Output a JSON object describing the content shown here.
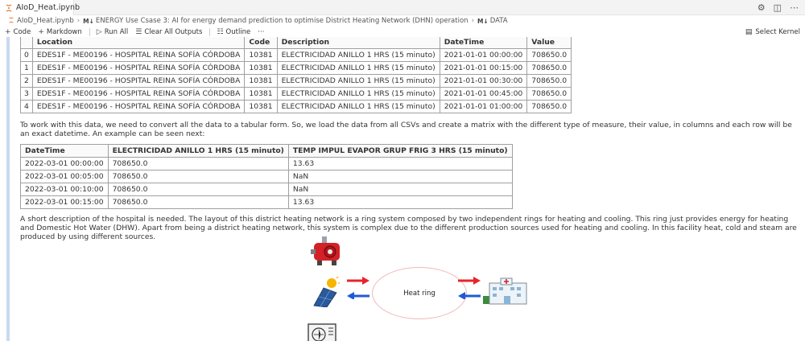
{
  "tab": {
    "title": "AIoD_Heat.ipynb"
  },
  "breadcrumb": {
    "file": "AIoD_Heat.ipynb",
    "m4": "M↓",
    "section": "ENERGY Use Csase 3: AI for energy demand prediction to optimise District Heating Network (DHN) operation",
    "subsection": "DATA"
  },
  "toolbar": {
    "code": "Code",
    "markdown": "Markdown",
    "run_all": "Run All",
    "clear_outputs": "Clear All Outputs",
    "outline": "Outline",
    "more": "···",
    "select_kernel": "Select Kernel"
  },
  "table1": {
    "columns": [
      "",
      "Location",
      "Code",
      "Description",
      "DateTime",
      "Value"
    ],
    "rows": [
      [
        "0",
        "EDES1F - ME00196 - HOSPITAL REINA SOFÍA CÓRDOBA",
        "10381",
        "ELECTRICIDAD ANILLO 1 HRS (15 minuto)",
        "2021-01-01 00:00:00",
        "708650.0"
      ],
      [
        "1",
        "EDES1F - ME00196 - HOSPITAL REINA SOFÍA CÓRDOBA",
        "10381",
        "ELECTRICIDAD ANILLO 1 HRS (15 minuto)",
        "2021-01-01 00:15:00",
        "708650.0"
      ],
      [
        "2",
        "EDES1F - ME00196 - HOSPITAL REINA SOFÍA CÓRDOBA",
        "10381",
        "ELECTRICIDAD ANILLO 1 HRS (15 minuto)",
        "2021-01-01 00:30:00",
        "708650.0"
      ],
      [
        "3",
        "EDES1F - ME00196 - HOSPITAL REINA SOFÍA CÓRDOBA",
        "10381",
        "ELECTRICIDAD ANILLO 1 HRS (15 minuto)",
        "2021-01-01 00:45:00",
        "708650.0"
      ],
      [
        "4",
        "EDES1F - ME00196 - HOSPITAL REINA SOFÍA CÓRDOBA",
        "10381",
        "ELECTRICIDAD ANILLO 1 HRS (15 minuto)",
        "2021-01-01 01:00:00",
        "708650.0"
      ]
    ]
  },
  "para1": "To work with this data, we need to convert all the data to a tabular form. So, we load the data from all CSVs and create a matrix with the different type of measure, their value, in columns and each row will be an exact datetime. An example can be seen next:",
  "table2": {
    "columns": [
      "DateTime",
      "ELECTRICIDAD ANILLO 1 HRS (15 minuto)",
      "TEMP IMPUL EVAPOR GRUP FRIG 3 HRS (15 minuto)"
    ],
    "rows": [
      [
        "2022-03-01 00:00:00",
        "708650.0",
        "13.63"
      ],
      [
        "2022-03-01 00:05:00",
        "708650.0",
        "NaN"
      ],
      [
        "2022-03-01 00:10:00",
        "708650.0",
        "NaN"
      ],
      [
        "2022-03-01 00:15:00",
        "708650.0",
        "13.63"
      ]
    ]
  },
  "para2": "A short description of the hospital is needed. The layout of this district heating network is a ring system composed by two independent rings for heating and cooling. This ring just provides energy for heating and Domestic Hot Water (DHW). Apart from being a district heating network, this system is complex due to the different production sources used for heating and cooling. In this facility heat, cold and steam are produced by using different sources.",
  "diagram": {
    "ring_label": "Heat ring",
    "icons": [
      "boiler-icon",
      "solar-panel-icon",
      "hospital-icon",
      "cooling-unit-icon"
    ],
    "colors": {
      "supply_arrow": "#e8242a",
      "return_arrow": "#1f5ad6",
      "ring_border": "#f2b8b8"
    }
  }
}
